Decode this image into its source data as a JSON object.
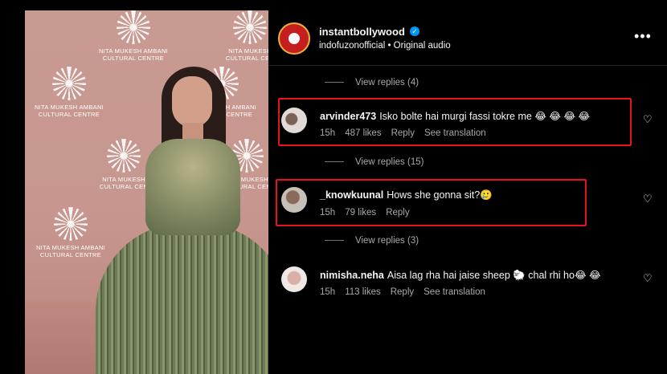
{
  "photo": {
    "wall_logo_text": "NITA MUKESH AMBANI\nCULTURAL CENTRE",
    "wall_logo_short": "NITA MUKESH\nCULTURAL CEN"
  },
  "header": {
    "author": "instantbollywood",
    "subline": "indofuzonofficial • Original audio",
    "more": "•••"
  },
  "replies": [
    {
      "label": "View replies (4)"
    },
    {
      "label": "View replies (15)"
    },
    {
      "label": "View replies (3)"
    }
  ],
  "comments": [
    {
      "username": "arvinder473",
      "text": "Isko bolte hai murgi fassi tokre me 😂 😂 😂 😂",
      "time": "15h",
      "likes": "487 likes",
      "reply": "Reply",
      "translate": "See translation"
    },
    {
      "username": "_knowkuunal",
      "text": "Hows she gonna sit?🥲",
      "time": "15h",
      "likes": "79 likes",
      "reply": "Reply",
      "translate": ""
    },
    {
      "username": "nimisha.neha",
      "text": "Aisa lag rha hai jaise sheep 🐑 chal rhi ho😂 😂",
      "time": "15h",
      "likes": "113 likes",
      "reply": "Reply",
      "translate": "See translation"
    }
  ],
  "colors": {
    "highlight": "#e8121a",
    "verified": "#0095f6",
    "muted_text": "#a8a8a8"
  },
  "icons": {
    "verified": "✓",
    "heart": "♡"
  }
}
